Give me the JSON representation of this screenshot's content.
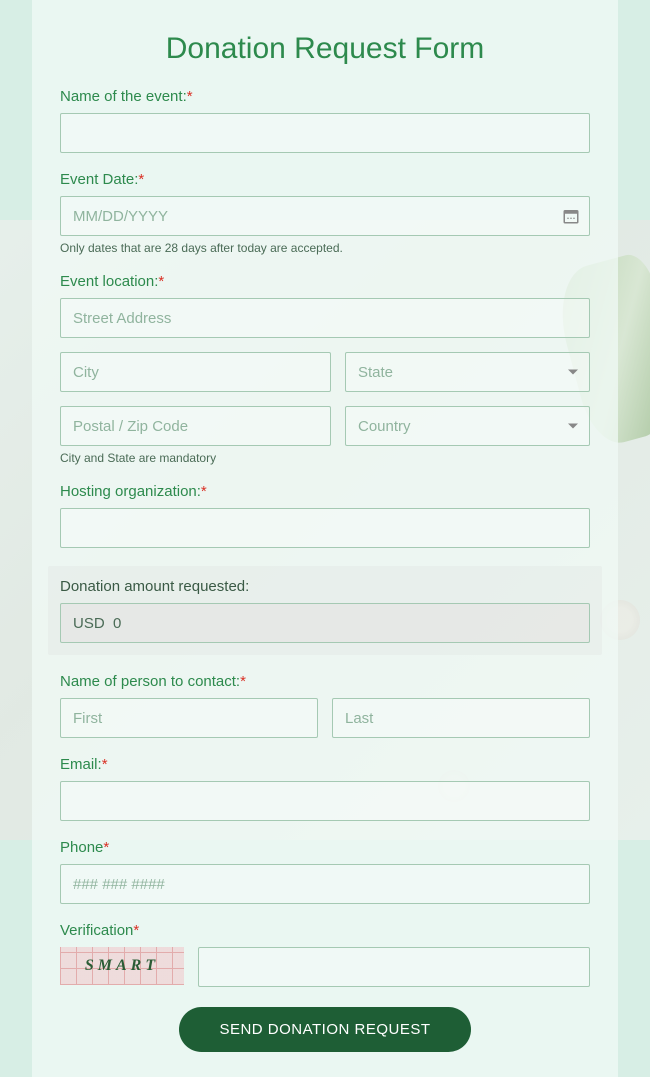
{
  "title": "Donation Request Form",
  "fields": {
    "event_name": {
      "label": "Name of the event:"
    },
    "event_date": {
      "label": "Event Date:",
      "placeholder": "MM/DD/YYYY",
      "helper": "Only dates that are 28 days after today are accepted."
    },
    "location": {
      "label": "Event location:",
      "street_ph": "Street Address",
      "city_ph": "City",
      "state_ph": "State",
      "postal_ph": "Postal / Zip Code",
      "country_ph": "Country",
      "helper": "City and State are mandatory"
    },
    "hosting_org": {
      "label": "Hosting organization:"
    },
    "amount": {
      "label": "Donation amount requested:",
      "currency": "USD",
      "value": "0"
    },
    "contact": {
      "label": "Name of person to contact:",
      "first_ph": "First",
      "last_ph": "Last"
    },
    "email": {
      "label": "Email:"
    },
    "phone": {
      "label": "Phone",
      "placeholder": "### ### ####"
    },
    "verification": {
      "label": "Verification",
      "captcha_text": "SMART"
    }
  },
  "submit_label": "SEND DONATION REQUEST"
}
